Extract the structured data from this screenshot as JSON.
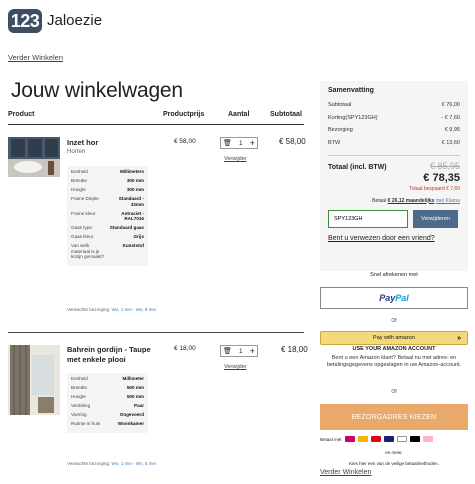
{
  "header": {
    "logo_number": "123",
    "logo_text": "Jaloezie",
    "continue_shopping": "Verder Winkelen"
  },
  "page_title": "Jouw winkelwagen",
  "table_headers": {
    "product": "Product",
    "price": "Productprijs",
    "quantity": "Aantal",
    "subtotal": "Subtotaal"
  },
  "items": [
    {
      "name": "Inzet hor",
      "subtitle": "Horren",
      "price": "€ 58,00",
      "quantity": "1",
      "subtotal": "€ 58,00",
      "remove": "Verwijder",
      "specs": [
        {
          "k": "Eenheid",
          "v": "Millimeters"
        },
        {
          "k": "Breedte",
          "v": "300 mm"
        },
        {
          "k": "Hoogte",
          "v": "300 mm"
        },
        {
          "k": "Frame Diepte",
          "v": "Standaard - 33mm"
        },
        {
          "k": "Frame kleur",
          "v": "Antraciet - RAL7016"
        },
        {
          "k": "Gaas type",
          "v": "Standaard gaas"
        },
        {
          "k": "Gaas kleur",
          "v": "Grijs"
        },
        {
          "k": "Van welk materiaal is je kozijn gemaakt?",
          "v": "Kunststof"
        }
      ],
      "delivery_label": "Verwachte bezorging:",
      "delivery_value": "Wo, 1 mei - Wo, 8 mei"
    },
    {
      "name": "Bahrein gordijn - Taupe met enkele plooi",
      "subtitle": "",
      "price": "€ 18,00",
      "quantity": "1",
      "subtotal": "€ 18,00",
      "remove": "Verwijder",
      "specs": [
        {
          "k": "Eenheid",
          "v": "Millimeter"
        },
        {
          "k": "Breedte",
          "v": "500 mm"
        },
        {
          "k": "Hoogte",
          "v": "500 mm"
        },
        {
          "k": "Verdeling",
          "v": "Paar"
        },
        {
          "k": "Voering",
          "v": "Ongevoerd"
        },
        {
          "k": "Ruimte in huis",
          "v": "Woonkamer"
        }
      ],
      "delivery_label": "Verwachte bezorging:",
      "delivery_value": "Wo, 1 mei - Wo, 8 mei"
    }
  ],
  "summary": {
    "title": "Samenvatting",
    "rows": [
      {
        "label": "Subtotaal",
        "value": "€ 76,00"
      },
      {
        "label": "Korting(SPY123GH)",
        "value": "- € 7,60"
      },
      {
        "label": "Bezorging",
        "value": "€ 9,95"
      },
      {
        "label": "BTW",
        "value": "€ 13,60"
      }
    ],
    "total_label": "Totaal (incl. BTW)",
    "old_price": "€ 85,95",
    "new_price": "€ 78,35",
    "saved": "Totaal bespaard € 7,60",
    "klarna_pre": "Betaal",
    "klarna_amount": "€ 26,12 maandelijks",
    "klarna_with": "met Klarna",
    "coupon_value": "SPY123GH",
    "coupon_button": "Verwijderen",
    "voucher_question": "Bent u verwezen door een vriend?"
  },
  "checkout": {
    "fast_pay": "Snel afrekenen met",
    "paypal_1": "Pay",
    "paypal_2": "Pal",
    "or_1": "Of",
    "amazon_button": "Pay with amazon",
    "amazon_sub": "USE YOUR AMAZON ACCOUNT",
    "amazon_desc": "Bent u een Amazon klant? Betaal nu met adres- en betalingsgegevens opgeslagen in uw Amazon-account.",
    "or_2": "Of",
    "address_button": "BEZORGADRES KIEZEN",
    "pay_with": "Betaal met",
    "more": "en meer.",
    "choose": "Kies hier een van de veilige betaalmethoden.",
    "continue_shopping": "Verder Winkelen"
  },
  "colors": {
    "accent": "#3d4d63",
    "cta": "#e8a96a",
    "coupon_button": "#4d6a8a",
    "discount_red": "#c0392b"
  }
}
